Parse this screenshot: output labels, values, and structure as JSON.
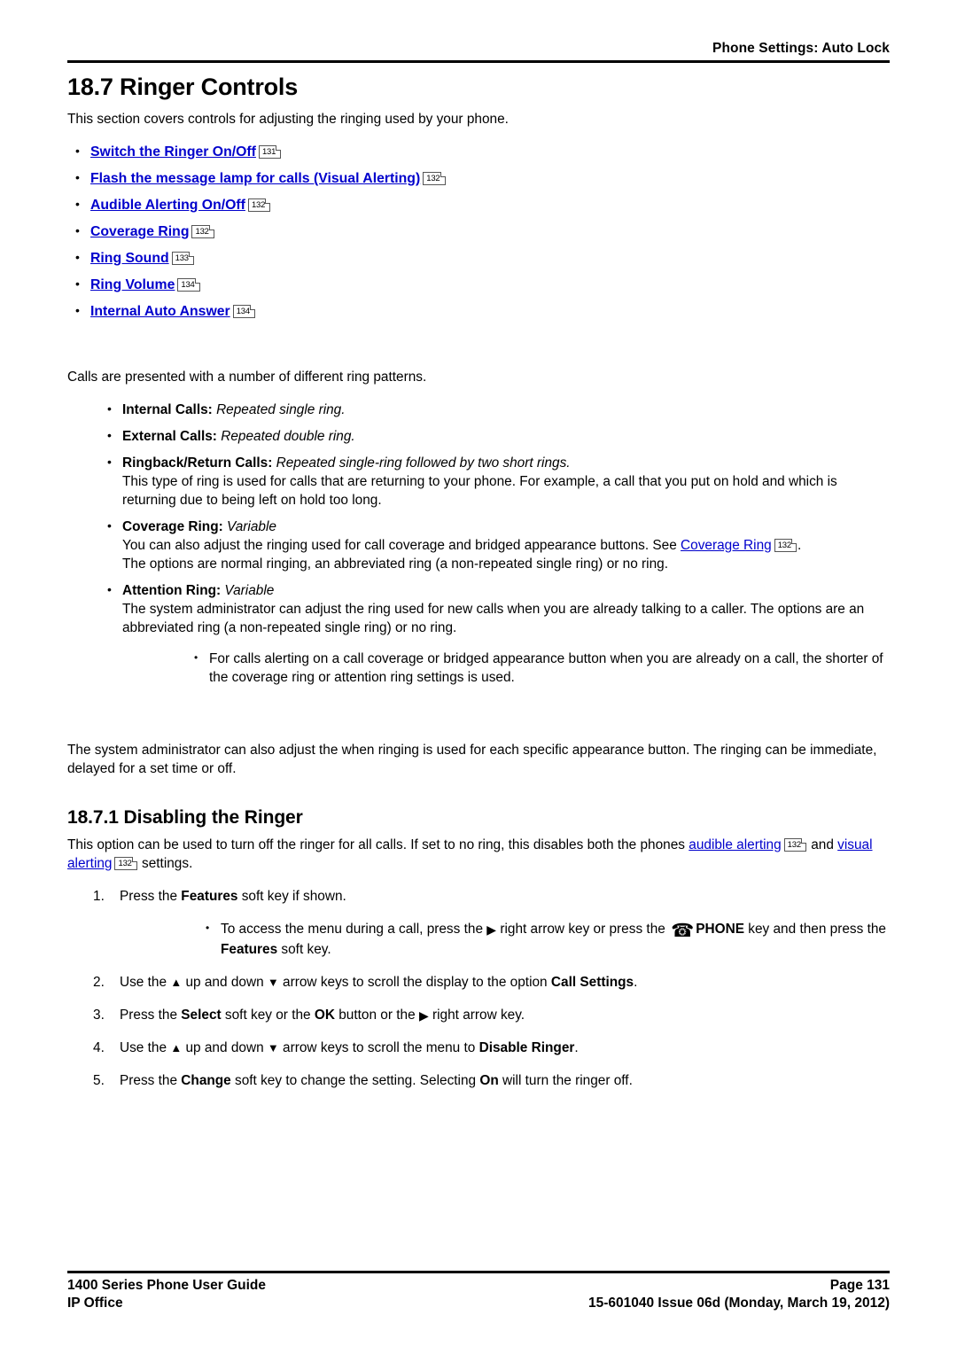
{
  "header": {
    "breadcrumb": "Phone Settings: Auto Lock"
  },
  "section": {
    "number_title": "18.7 Ringer Controls",
    "intro": "This section covers controls for adjusting the ringing used by your phone.",
    "toc_links": [
      {
        "label": "Switch the Ringer On/Off",
        "page_ref": "131"
      },
      {
        "label": "Flash the message lamp for calls (Visual Alerting)",
        "page_ref": "132"
      },
      {
        "label": "Audible Alerting On/Off",
        "page_ref": "132"
      },
      {
        "label": "Coverage Ring",
        "page_ref": "132"
      },
      {
        "label": "Ring Sound",
        "page_ref": "133"
      },
      {
        "label": "Ring Volume",
        "page_ref": "134"
      },
      {
        "label": "Internal Auto Answer",
        "page_ref": "134"
      }
    ],
    "patterns_intro": "Calls are presented with a number of different ring patterns.",
    "patterns": [
      {
        "term": "Internal Calls:",
        "value": "Repeated single ring.",
        "body": ""
      },
      {
        "term": "External Calls:",
        "value": "Repeated double ring.",
        "body": ""
      },
      {
        "term": "Ringback/Return Calls:",
        "value": "Repeated single-ring followed by two short rings.",
        "body": "This type of ring is used for calls that are returning to your phone. For example, a call that you put on hold and which is returning due to being left on hold too long."
      },
      {
        "term": "Coverage Ring:",
        "value": "Variable",
        "body_pre_link": "You can also adjust the ringing used for call coverage and bridged appearance buttons. See ",
        "body_link": "Coverage Ring",
        "body_link_ref": "132",
        "body_post_link": ".",
        "body_line2": "The options are normal ringing, an abbreviated ring (a non-repeated single ring) or no ring."
      },
      {
        "term": "Attention Ring:",
        "value": "Variable",
        "body": "The system administrator can adjust the ring used for new calls when you are already talking to a caller. The options are an abbreviated ring (a non-repeated single ring) or no ring.",
        "subbullet": "For calls alerting on a call coverage or bridged appearance button when you are already on a call, the shorter of the coverage ring or attention ring settings is used."
      }
    ],
    "closing_paragraph": "The system administrator can also adjust the when ringing is used for each specific appearance button. The ringing can be immediate, delayed for a set time or off."
  },
  "subsection": {
    "number_title": "18.7.1 Disabling the Ringer",
    "intro_pre_link1": "This option can be used to turn off the ringer for all calls. If set to no ring, this disables both the phones ",
    "intro_link1": "audible alerting",
    "intro_link1_ref": "132",
    "intro_mid": " and ",
    "intro_link2": "visual alerting",
    "intro_link2_ref": "132",
    "intro_post": " settings.",
    "steps": [
      {
        "pre": "Press the ",
        "bold1": "Features",
        "post": " soft key if shown.",
        "substep": {
          "a": "To access the menu during a call, press the ",
          "icon_right": "right-arrow-icon",
          "b": " right arrow key or press the ",
          "icon_phone": "phone-icon",
          "c_bold": "PHONE",
          "d": " key and then press the ",
          "e_bold": "Features",
          "f": " soft key."
        }
      },
      {
        "pre": "Use the ",
        "icon_up": "up-arrow-icon",
        "mid1": " up and down ",
        "icon_down": "down-arrow-icon",
        "mid2": " arrow keys to scroll the display to the option ",
        "bold1": "Call Settings",
        "post": "."
      },
      {
        "pre": "Press the ",
        "bold1": "Select",
        "mid1": " soft key or the ",
        "bold2": "OK",
        "mid2": " button or the ",
        "icon_right": "right-arrow-icon",
        "post": " right arrow key."
      },
      {
        "pre": "Use the ",
        "icon_up": "up-arrow-icon",
        "mid1": " up and down ",
        "icon_down": "down-arrow-icon",
        "mid2": " arrow keys to scroll the menu to ",
        "bold1": "Disable Ringer",
        "post": "."
      },
      {
        "pre": "Press the ",
        "bold1": "Change",
        "mid1": " soft key to change the setting. Selecting ",
        "bold2": "On",
        "post": " will turn the ringer off."
      }
    ]
  },
  "footer": {
    "left_line1": "1400 Series Phone User Guide",
    "left_line2": "IP Office",
    "right_line1": "Page 131",
    "right_line2": "15-601040 Issue 06d (Monday, March 19, 2012)"
  },
  "icons": {
    "right_arrow": "▶",
    "up_arrow": "▲",
    "down_arrow": "▼",
    "phone": "☎",
    "bullet": "•"
  },
  "colors": {
    "link": "#0000cc",
    "text": "#000000",
    "background": "#ffffff"
  }
}
